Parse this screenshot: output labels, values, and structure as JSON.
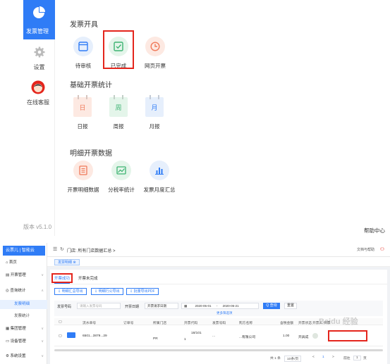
{
  "top": {
    "rail": {
      "active": {
        "label": "发票管理",
        "icon": "pie-chart-icon"
      },
      "items": [
        {
          "label": "设置",
          "icon": "gear-icon"
        },
        {
          "label": "在线客服",
          "icon": "support-avatar-icon"
        }
      ],
      "version": "版本 v5.1.0"
    },
    "sections": {
      "issue": {
        "title": "发票开具",
        "tiles": [
          {
            "label": "待审核",
            "icon": "window-icon",
            "color": "#2f7cf6",
            "bg": "#e6effc"
          },
          {
            "label": "已完成",
            "icon": "check-square-icon",
            "color": "#3cb371",
            "bg": "#e4f5ea"
          },
          {
            "label": "网页开票",
            "icon": "clock-icon",
            "color": "#f07a5a",
            "bg": "#fde9e2"
          }
        ]
      },
      "stats": {
        "title": "基础开票统计",
        "tiles": [
          {
            "label": "日报",
            "glyph": "日",
            "color": "#f07a5a",
            "bg": "#fde9e2"
          },
          {
            "label": "周报",
            "glyph": "周",
            "color": "#3cb371",
            "bg": "#e4f5ea"
          },
          {
            "label": "月报",
            "glyph": "月",
            "color": "#2f7cf6",
            "bg": "#e6effc"
          }
        ]
      },
      "detail": {
        "title": "明细开票数据",
        "tiles": [
          {
            "label": "开票明细数据",
            "icon": "document-list-icon",
            "color": "#f07a5a",
            "bg": "#fde9e2"
          },
          {
            "label": "分税率统计",
            "icon": "image-chart-icon",
            "color": "#3cb371",
            "bg": "#e4f5ea"
          },
          {
            "label": "发票月度汇总",
            "icon": "bar-chart-icon",
            "color": "#2f7cf6",
            "bg": "#e6effc"
          }
        ]
      }
    },
    "help": "帮助中心"
  },
  "bottom": {
    "logo": "云票儿 | 智能云",
    "side": [
      {
        "label": "首页",
        "icon": "home-icon"
      },
      {
        "label": "开票管理",
        "icon": "invoice-icon",
        "arrow": "∨"
      },
      {
        "label": "查询统计",
        "icon": "search-icon",
        "arrow": "∧"
      },
      {
        "label": "发票明细",
        "sub": true,
        "active": true
      },
      {
        "label": "发票统计",
        "sub": true
      },
      {
        "label": "集团管理",
        "icon": "group-icon",
        "arrow": "∨"
      },
      {
        "label": "设备管理",
        "icon": "device-icon",
        "arrow": "∨"
      },
      {
        "label": "系统设置",
        "icon": "settings-icon",
        "arrow": "∨"
      }
    ],
    "header": {
      "crumb": "门店: 所有门店数据汇总 >",
      "right": "文档与帮助"
    },
    "tag": "发票明细 ⊗",
    "tabs": {
      "done": "开票成功",
      "undone": "开票未完成"
    },
    "buttons": [
      "明细汇总导出",
      "明细行公导出",
      "批量导出PDF"
    ],
    "filter": {
      "invoice_no_label": "发票号码",
      "invoice_no_placeholder": "请输入发票号码",
      "date_label": "开票日期",
      "date_type": "开票请求日期",
      "date_from": "2020-05-01",
      "date_sep": "-",
      "date_to": "2020-05-21",
      "search": "Q 查询",
      "reset": "重置",
      "more": "更多筛选项"
    },
    "table": {
      "headers": [
        "",
        "",
        "流水单号",
        "订单号",
        "所属门店",
        "开票代码",
        "发票号码",
        "购方名称",
        "含税金额",
        "开票状态",
        "开票人",
        "开票"
      ],
      "row": {
        "serial": "6501...3879...29",
        "store": "PR",
        "code": "18/101",
        "code2": "1",
        "number": "...",
        "buyer": "...有限公司",
        "amount": "1.00",
        "status": "开具成"
      }
    },
    "pager": {
      "total": "共 1 条",
      "size": "10条/页",
      "prev": "<",
      "page": "1",
      "next": ">",
      "goto": "前往",
      "goto_page": "1",
      "page_suffix": "页"
    }
  },
  "watermark": "Baidu 经验"
}
